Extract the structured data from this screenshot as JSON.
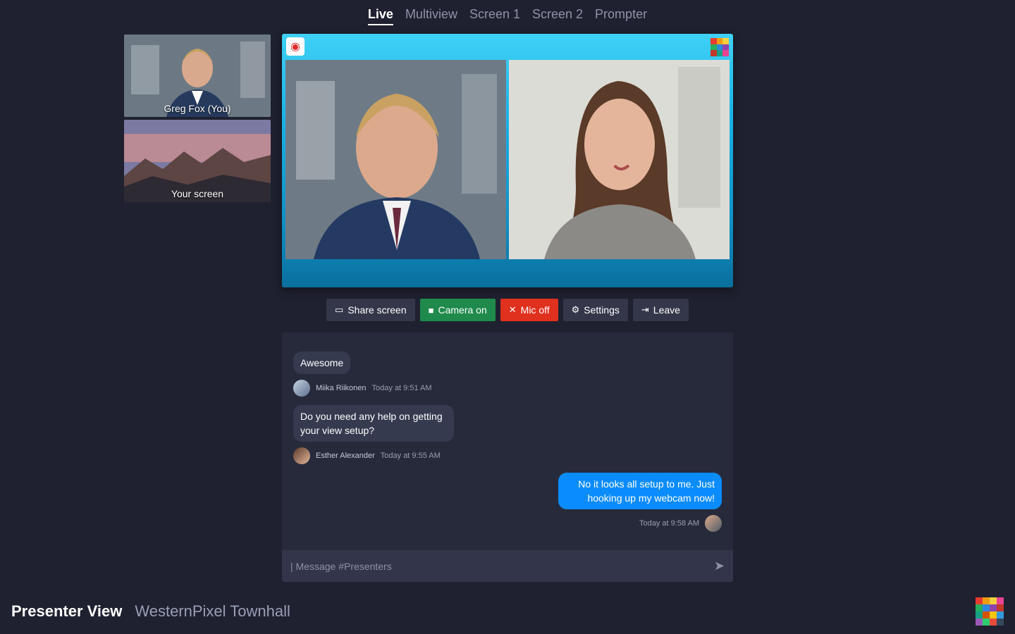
{
  "tabs": [
    {
      "label": "Live",
      "active": true
    },
    {
      "label": "Multiview",
      "active": false
    },
    {
      "label": "Screen 1",
      "active": false
    },
    {
      "label": "Screen 2",
      "active": false
    },
    {
      "label": "Prompter",
      "active": false
    }
  ],
  "sources": {
    "camera_label": "Greg Fox (You)",
    "screen_label": "Your screen"
  },
  "controls": {
    "share_label": "Share screen",
    "camera_label": "Camera on",
    "mic_label": "Mic off",
    "settings_label": "Settings",
    "leave_label": "Leave"
  },
  "chat": {
    "messages": [
      {
        "text": "Awesome",
        "author": "Miika Riikonen",
        "time": "Today at 9:51 AM"
      },
      {
        "text": "Do you need any help on getting your view setup?",
        "author": "Esther Alexander",
        "time": "Today at 9:55 AM"
      }
    ],
    "own_message": {
      "text": "No it looks all setup to me.  Just hooking up my webcam now!",
      "time": "Today at 9:58 AM"
    },
    "placeholder": "| Message #Presenters"
  },
  "footer": {
    "title": "Presenter View",
    "event_name": "WesternPixel Townhall"
  },
  "colors": {
    "background": "#1f2130",
    "camera_on": "#1f8a4c",
    "mic_off": "#e0301e",
    "own_bubble": "#0a8cff"
  }
}
